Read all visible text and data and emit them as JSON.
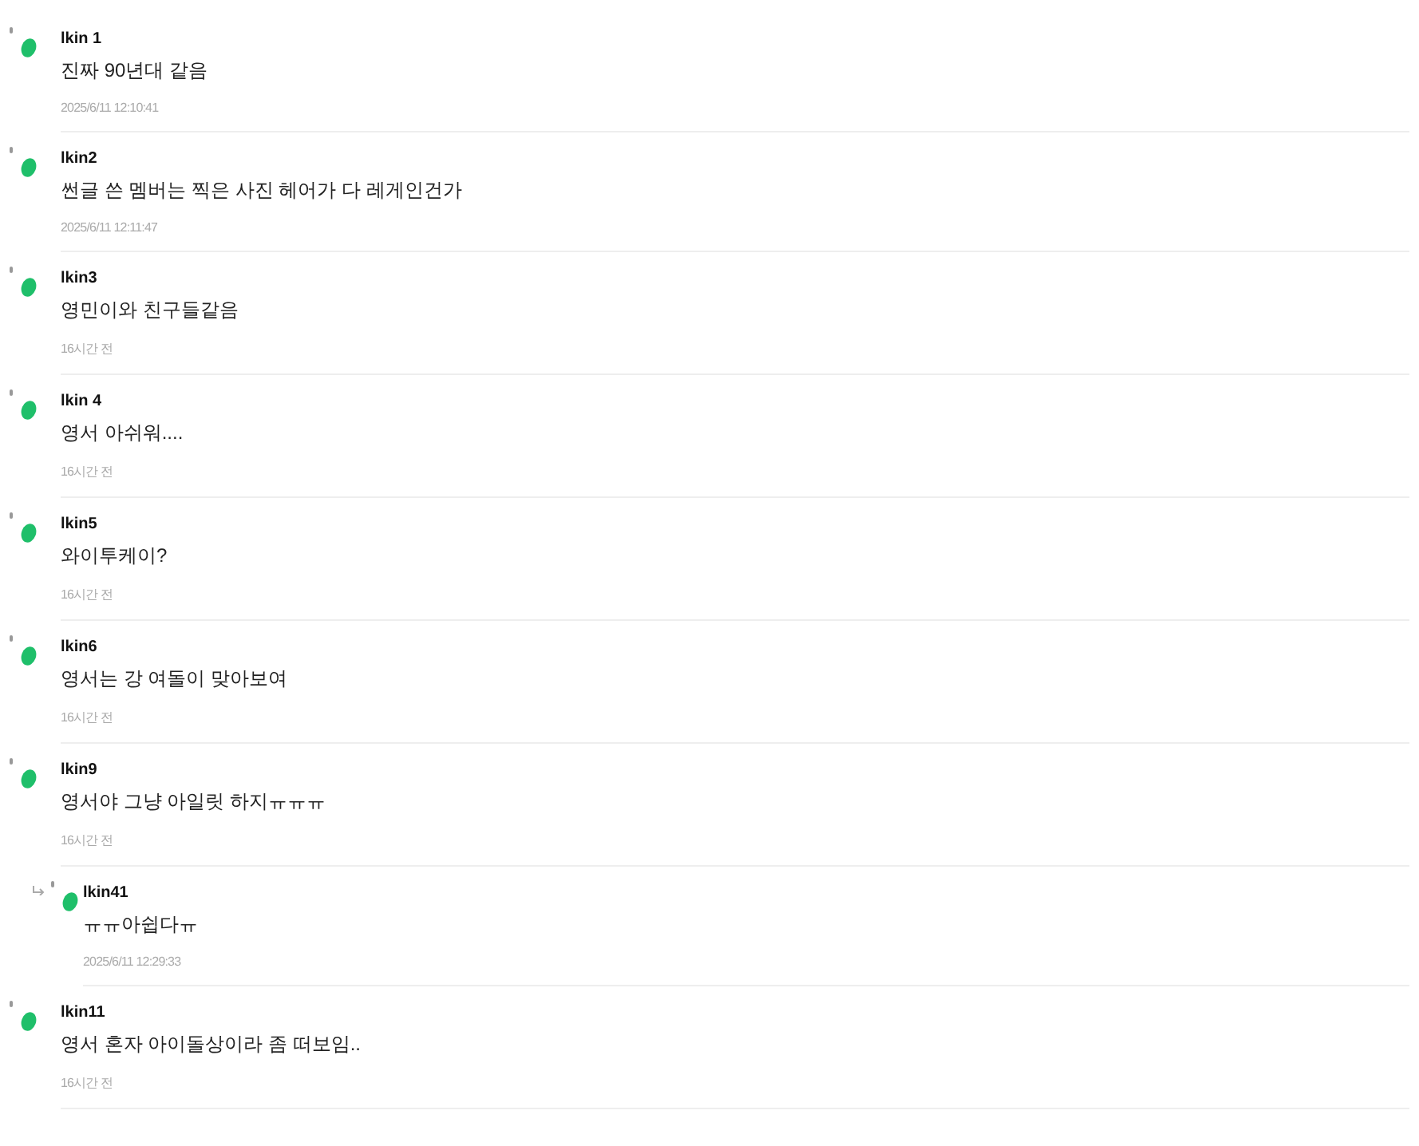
{
  "comments": [
    {
      "author": "lkin 1",
      "text": "진짜 90년대 같음",
      "time": "2025/6/11 12:10:41"
    },
    {
      "author": "lkin2",
      "text": "썬글 쓴 멤버는 찍은 사진 헤어가 다 레게인건가",
      "time": "2025/6/11 12:11:47"
    },
    {
      "author": "lkin3",
      "text": "영민이와 친구들같음",
      "time": "16시간 전"
    },
    {
      "author": "lkin 4",
      "text": "영서 아쉬워....",
      "time": "16시간 전"
    },
    {
      "author": "lkin5",
      "text": "와이투케이?",
      "time": "16시간 전"
    },
    {
      "author": "lkin6",
      "text": "영서는 강 여돌이 맞아보여",
      "time": "16시간 전"
    },
    {
      "author": "lkin9",
      "text": "영서야 그냥 아일릿 하지ㅠㅠㅠ",
      "time": "16시간 전",
      "replies": [
        {
          "author": "lkin41",
          "text": "ㅠㅠ아쉽다ㅠ",
          "time": "2025/6/11 12:29:33"
        }
      ]
    },
    {
      "author": "lkin11",
      "text": "영서 혼자 아이돌상이라 좀 떠보임..",
      "time": "16시간 전"
    }
  ]
}
